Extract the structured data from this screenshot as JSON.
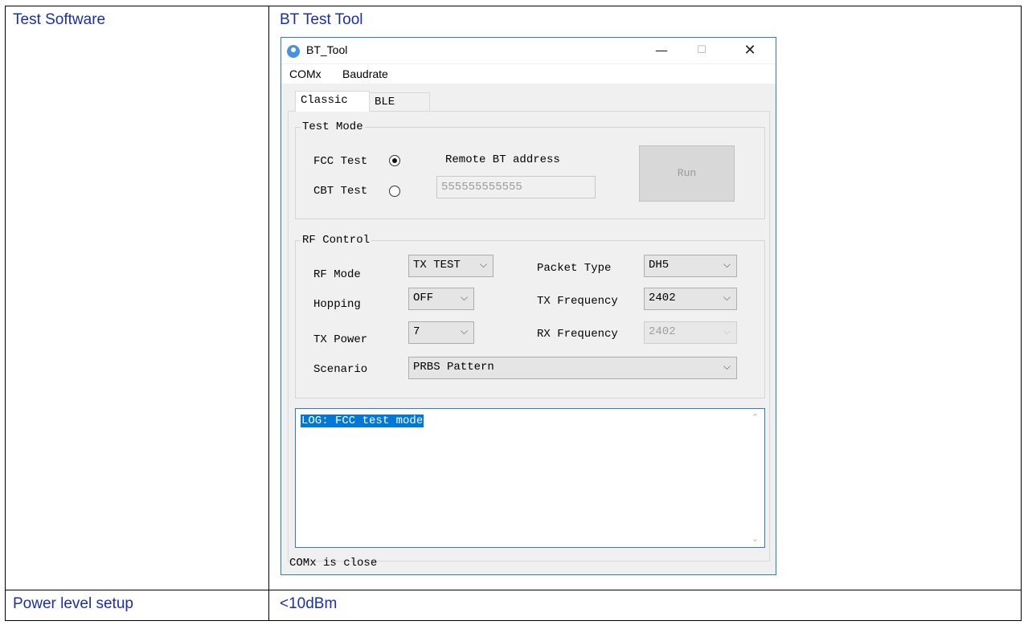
{
  "doc": {
    "row1_label": "Test Software",
    "row1_value": "BT Test Tool",
    "row2_label": "Power level setup",
    "row2_value": "<10dBm"
  },
  "window": {
    "title": "BT_Tool",
    "minimize": "—",
    "maximize": "☐",
    "close": "✕"
  },
  "menu": {
    "com": "COMx",
    "baudrate": "Baudrate"
  },
  "tabs": [
    {
      "label": "Classic",
      "active": true
    },
    {
      "label": "BLE",
      "active": false
    }
  ],
  "test_mode": {
    "legend": "Test Mode",
    "fcc_label": "FCC Test",
    "cbt_label": "CBT Test",
    "selected": "FCC Test",
    "address_label": "Remote BT address",
    "address_value": "555555555555",
    "run_label": "Run"
  },
  "rf_control": {
    "legend": "RF Control",
    "rf_mode_label": "RF Mode",
    "rf_mode_value": "TX TEST",
    "packet_type_label": "Packet Type",
    "packet_type_value": "DH5",
    "hopping_label": "Hopping",
    "hopping_value": "OFF",
    "tx_freq_label": "TX Frequency",
    "tx_freq_value": "2402",
    "tx_power_label": "TX Power",
    "tx_power_value": "7",
    "rx_freq_label": "RX Frequency",
    "rx_freq_value": "2402",
    "scenario_label": "Scenario",
    "scenario_value": "PRBS Pattern"
  },
  "log": {
    "text": "LOG: FCC test mode"
  },
  "status": {
    "text": "COMx is close"
  },
  "icons": {
    "dropdown": "chevron-down-icon",
    "app": "bluetooth-app-icon"
  }
}
